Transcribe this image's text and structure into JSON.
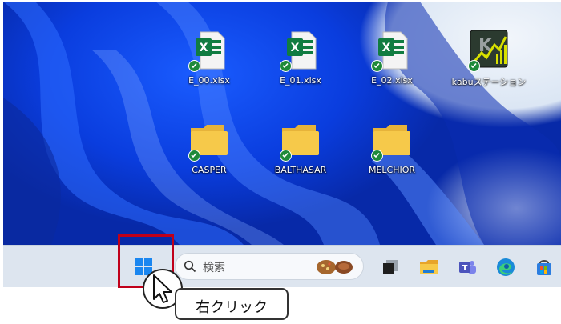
{
  "desktop": {
    "icons": [
      {
        "label": "E_00.xlsx",
        "type": "excel-file-icon",
        "synced": true
      },
      {
        "label": "E_01.xlsx",
        "type": "excel-file-icon",
        "synced": true
      },
      {
        "label": "E_02.xlsx",
        "type": "excel-file-icon",
        "synced": true
      },
      {
        "label": "kabuステーション",
        "type": "kabu-station-app-icon",
        "synced": true
      },
      {
        "label": "CASPER",
        "type": "folder-icon",
        "synced": true
      },
      {
        "label": "BALTHASAR",
        "type": "folder-icon",
        "synced": true
      },
      {
        "label": "MELCHIOR",
        "type": "folder-icon",
        "synced": true
      }
    ]
  },
  "taskbar": {
    "start_icon": "windows-start-icon",
    "search": {
      "placeholder": "検索",
      "icon": "search-icon"
    },
    "apps": [
      "task-view-icon",
      "file-explorer-icon",
      "teams-icon",
      "edge-icon",
      "store-icon"
    ]
  },
  "annotation": {
    "callout_text": "右クリック",
    "highlight_color": "#c0001a"
  },
  "colors": {
    "excel_green": "#107c41",
    "folder_yellow": "#f6c94a",
    "sync_green": "#1f8a3a",
    "start_blue": "#1a86f0"
  }
}
